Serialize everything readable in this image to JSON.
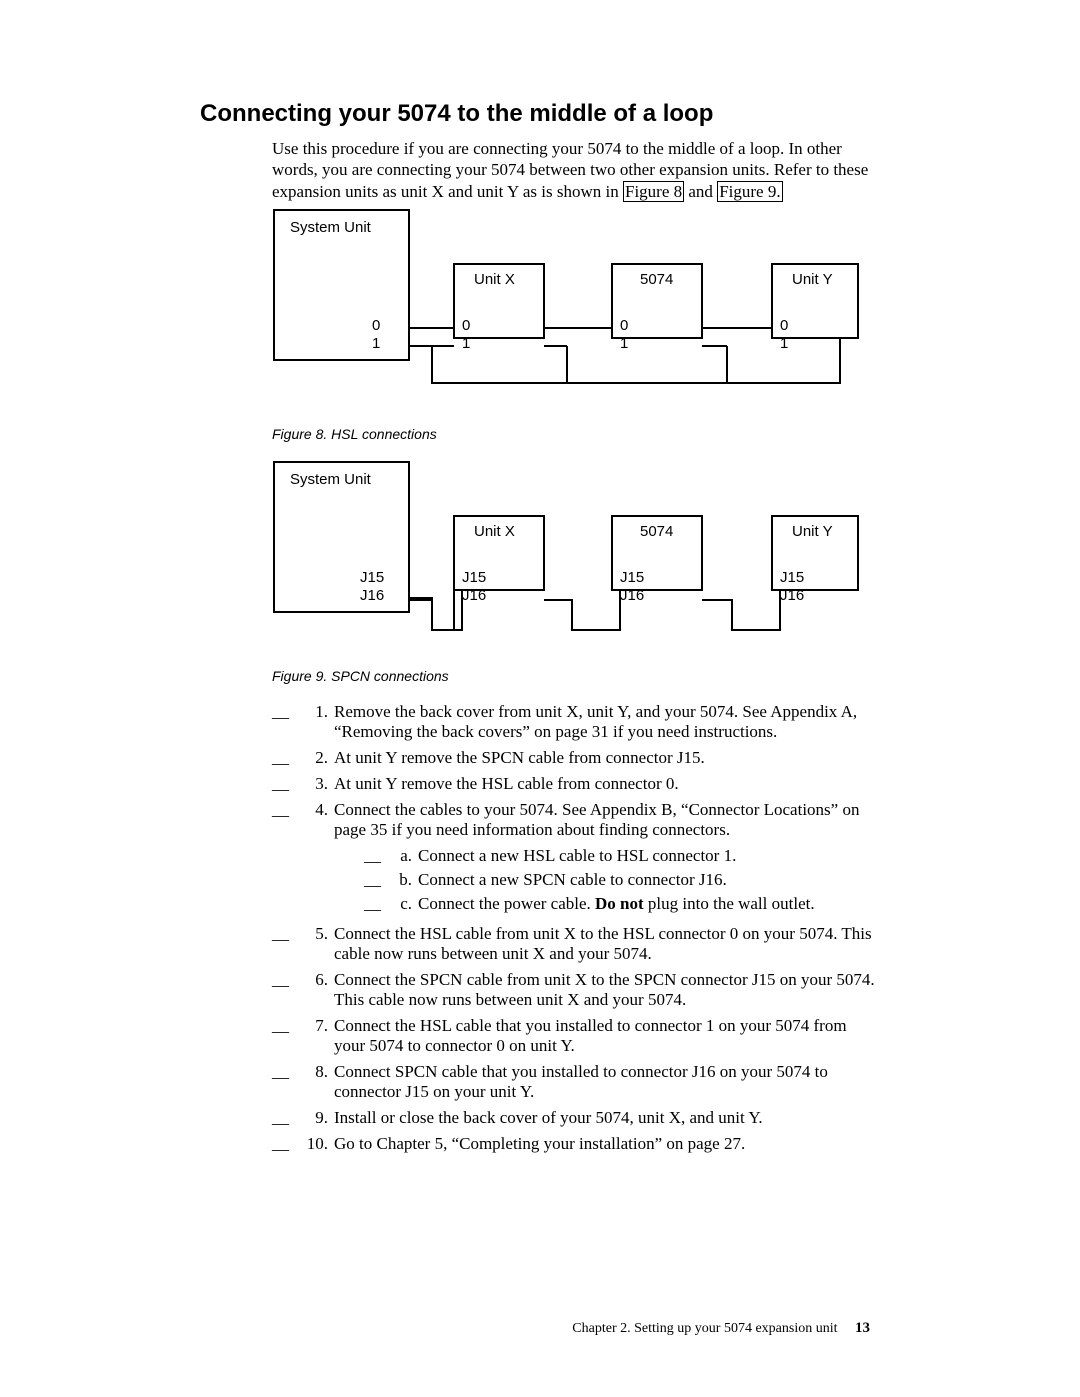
{
  "title": "Connecting your 5074 to the middle of a loop",
  "intro_part1": "Use this procedure if you are connecting your 5074 to the middle of a loop. In other words, you are connecting your 5074 between two other expansion units. Refer to these expansion units as unit X and unit Y as is shown in ",
  "xref8": "Figure 8",
  "intro_and": " and ",
  "xref9": "Figure 9.",
  "fig8": {
    "caption": "Figure 8. HSL connections",
    "sysunit": "System Unit",
    "unitx": "Unit X",
    "b5074": "5074",
    "unity": "Unit Y",
    "p0": "0",
    "p1": "1"
  },
  "fig9": {
    "caption": "Figure 9. SPCN connections",
    "sysunit": "System Unit",
    "unitx": "Unit X",
    "b5074": "5074",
    "unity": "Unit Y",
    "j15": "J15",
    "j16": "J16"
  },
  "steps": [
    {
      "n": "1.",
      "t": "Remove the back cover from unit X, unit Y, and your 5074. See Appendix A, “Removing the back covers” on page 31 if you need instructions."
    },
    {
      "n": "2.",
      "t": "At unit Y remove the SPCN cable from connector J15."
    },
    {
      "n": "3.",
      "t": "At unit Y remove the HSL cable from connector 0."
    },
    {
      "n": "4.",
      "t": "Connect the cables to your 5074. See Appendix B, “Connector Locations” on page 35 if you need information about finding connectors.",
      "sub": [
        {
          "n": "a.",
          "t": "Connect a new HSL cable to HSL connector 1."
        },
        {
          "n": "b.",
          "t": "Connect a new SPCN cable to connector J16."
        },
        {
          "n": "c.",
          "t_pre": "Connect the power cable. ",
          "t_bold": "Do not",
          "t_post": " plug into the wall outlet."
        }
      ]
    },
    {
      "n": "5.",
      "t": "Connect the HSL cable from unit X to the HSL connector 0 on your 5074. This cable now runs between unit X and your 5074."
    },
    {
      "n": "6.",
      "t": "Connect the SPCN cable from unit X to the SPCN connector J15 on your 5074. This cable now runs between unit X and your 5074."
    },
    {
      "n": "7.",
      "t": "Connect the HSL cable that you installed to connector 1 on your 5074 from your 5074 to connector 0 on unit Y."
    },
    {
      "n": "8.",
      "t": "Connect SPCN cable that you installed to connector J16 on your 5074 to connector J15 on your unit Y."
    },
    {
      "n": "9.",
      "t": "Install or close the back cover of your 5074, unit X, and unit Y."
    },
    {
      "n": "10.",
      "t": "Go to Chapter 5, “Completing your installation” on page 27."
    }
  ],
  "footer_chapter": "Chapter 2. Setting up your 5074 expansion unit",
  "footer_page": "13",
  "check": "__"
}
